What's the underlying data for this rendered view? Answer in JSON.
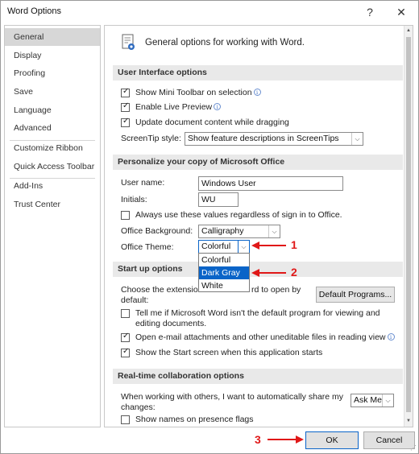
{
  "window": {
    "title": "Word Options",
    "help_glyph": "?",
    "close_glyph": "✕"
  },
  "sidebar": {
    "items": [
      {
        "label": "General"
      },
      {
        "label": "Display"
      },
      {
        "label": "Proofing"
      },
      {
        "label": "Save"
      },
      {
        "label": "Language"
      },
      {
        "label": "Advanced"
      },
      {
        "label": "Customize Ribbon"
      },
      {
        "label": "Quick Access Toolbar"
      },
      {
        "label": "Add-Ins"
      },
      {
        "label": "Trust Center"
      }
    ],
    "active": "General"
  },
  "main": {
    "header": "General options for working with Word.",
    "ui_options": {
      "title": "User Interface options",
      "mini_toolbar": "Show Mini Toolbar on selection",
      "live_preview": "Enable Live Preview",
      "update_dragging": "Update document content while dragging",
      "screentip_label": "ScreenTip style:",
      "screentip_value": "Show feature descriptions in ScreenTips"
    },
    "personalize": {
      "title": "Personalize your copy of Microsoft Office",
      "username_label": "User name:",
      "username_value": "Windows User",
      "initials_label": "Initials:",
      "initials_value": "WU",
      "always_use": "Always use these values regardless of sign in to Office.",
      "background_label": "Office Background:",
      "background_value": "Calligraphy",
      "theme_label": "Office Theme:",
      "theme_value": "Colorful",
      "theme_options": [
        "Colorful",
        "Dark Gray",
        "White"
      ],
      "theme_highlighted": "Dark Gray"
    },
    "startup": {
      "title": "Start up options",
      "choose_ext_1": "Choose the extension",
      "choose_ext_2": "rd to open by",
      "choose_ext_3": "default:",
      "default_programs": "Default Programs...",
      "tell_me_1": "Tell me if Microsoft Word isn't the default program for viewing and",
      "tell_me_2": "editing documents.",
      "open_email": "Open e-mail attachments and other uneditable files in reading view",
      "show_start": "Show the Start screen when this application starts"
    },
    "realtime": {
      "title": "Real-time collaboration options",
      "share_1": "When working with others, I want to automatically share my",
      "share_2": "changes:",
      "share_value": "Ask Me",
      "presence": "Show names on presence flags"
    }
  },
  "footer": {
    "ok": "OK",
    "cancel": "Cancel"
  },
  "annotations": {
    "one": "1",
    "two": "2",
    "three": "3",
    "color": "#e01818"
  },
  "colors": {
    "selection": "#0a64c8",
    "section_bg": "#e9e9e9",
    "sidebar_active": "#d7d7d7"
  }
}
